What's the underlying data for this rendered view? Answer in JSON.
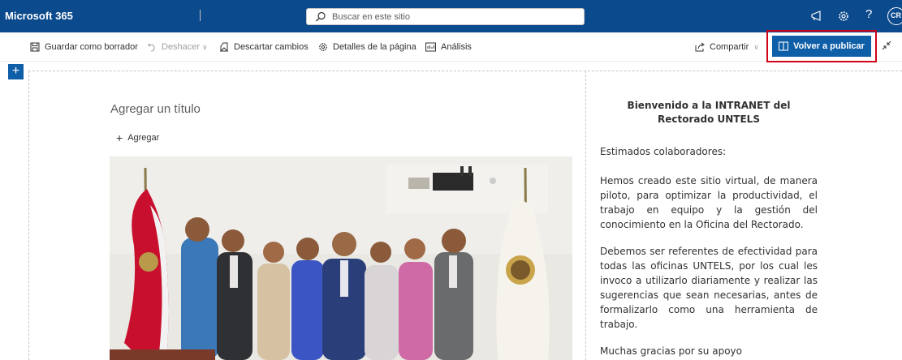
{
  "suite_bar": {
    "brand": "Microsoft 365",
    "search_placeholder": "Buscar en este sitio",
    "help": "?",
    "avatar_initials": "CR"
  },
  "command_bar": {
    "save_draft": "Guardar como borrador",
    "undo": "Deshacer",
    "discard": "Descartar cambios",
    "page_details": "Detalles de la página",
    "analytics": "Análisis",
    "share": "Compartir",
    "republish": "Volver a publicar"
  },
  "canvas": {
    "add_section": "+",
    "title_placeholder": "Agregar un título",
    "add_label": "Agregar"
  },
  "text_part": {
    "heading": "Bienvenido a la INTRANET del Rectorado UNTELS",
    "greeting": "Estimados colaboradores:",
    "paragraph1": "Hemos creado este sitio virtual, de manera piloto, para optimizar la productividad, el trabajo en equipo y la gestión del conocimiento en la Oficina del Rectorado.",
    "paragraph2": "Debemos ser referentes de efectividad para todas las oficinas UNTELS, por los cual les invoco a utilizarlo diariamente y realizar las sugerencias que sean necesarias, antes de formalizarlo como una herramienta de trabajo.",
    "thanks": "Muchas gracias por su apoyo"
  },
  "colors": {
    "suite_bar": "#0b4a8c",
    "primary_button": "#0f5ea8",
    "highlight_border": "#d0011b"
  },
  "icons": [
    "search-icon",
    "megaphone-icon",
    "gear-icon",
    "save-icon",
    "undo-icon",
    "discard-icon",
    "gear-icon",
    "analytics-icon",
    "share-icon",
    "book-icon",
    "collapse-icon"
  ]
}
